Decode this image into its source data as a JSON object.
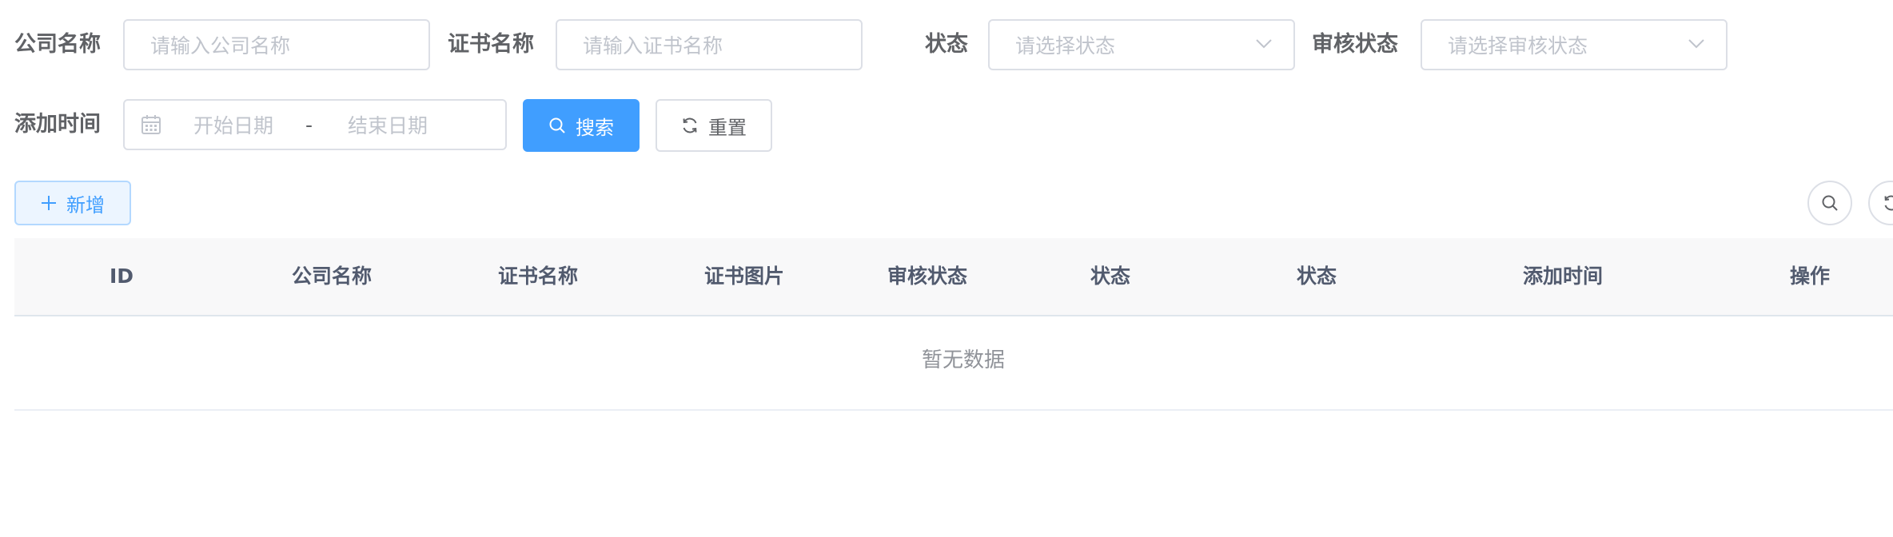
{
  "filters": {
    "company": {
      "label": "公司名称",
      "placeholder": "请输入公司名称"
    },
    "certificate": {
      "label": "证书名称",
      "placeholder": "请输入证书名称"
    },
    "status": {
      "label": "状态",
      "placeholder": "请选择状态"
    },
    "audit_status": {
      "label": "审核状态",
      "placeholder": "请选择审核状态"
    },
    "date_range": {
      "label": "添加时间",
      "start_placeholder": "开始日期",
      "separator": "-",
      "end_placeholder": "结束日期"
    }
  },
  "buttons": {
    "search": "搜索",
    "reset": "重置",
    "add": "新增"
  },
  "table": {
    "columns": [
      "ID",
      "公司名称",
      "证书名称",
      "证书图片",
      "审核状态",
      "状态",
      "状态",
      "添加时间",
      "操作"
    ],
    "empty_text": "暂无数据"
  },
  "colors": {
    "primary": "#409eff",
    "border": "#dcdfe6",
    "placeholder": "#c0c4cc",
    "header_bg": "#f8f8f9"
  }
}
